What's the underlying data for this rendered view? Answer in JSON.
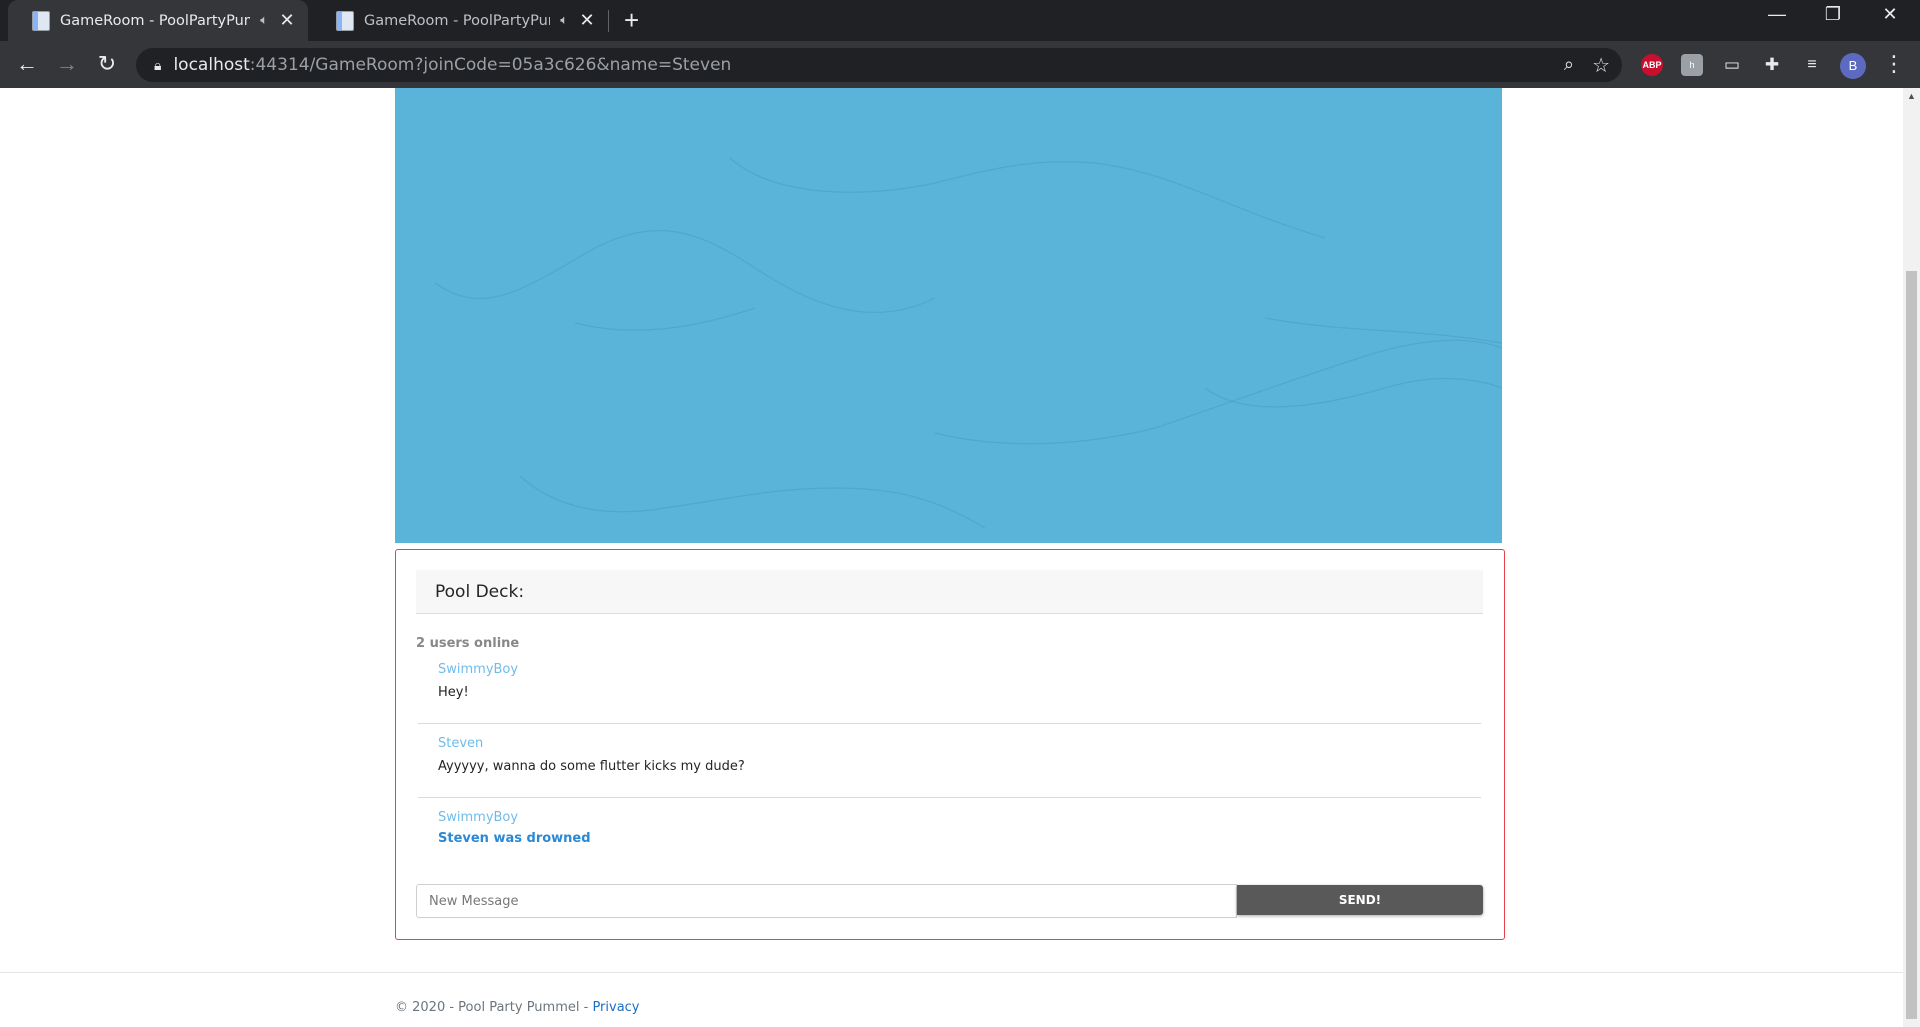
{
  "browser": {
    "tabs": [
      {
        "title": "GameRoom - PoolPartyPumm",
        "active": true
      },
      {
        "title": "GameRoom - PoolPartyPumm",
        "active": false
      }
    ],
    "url_host": "localhost",
    "url_rest": ":44314/GameRoom?joinCode=05a3c626&name=Steven",
    "extensions": [
      {
        "name": "adblock-icon",
        "label": "ABP",
        "color": "#c8102e"
      },
      {
        "name": "extension-h-icon",
        "label": "h",
        "color": "#9aa0a6"
      }
    ],
    "profile_initial": "B"
  },
  "pool": {
    "color": "#5ab3d8"
  },
  "deck": {
    "title": "Pool Deck:",
    "online_count": "2 users online",
    "messages": [
      {
        "user": "SwimmyBoy",
        "text": "Hey!"
      },
      {
        "user": "Steven",
        "text": "Ayyyyy, wanna do some flutter kicks my dude?"
      },
      {
        "user": "SwimmyBoy",
        "text": "Steven was drowned"
      }
    ],
    "input_placeholder": "New Message",
    "send_label": "SEND!",
    "border_color": "#e8414a"
  },
  "footer": {
    "copyright": "© 2020 - Pool Party Pummel - ",
    "privacy_label": "Privacy"
  }
}
